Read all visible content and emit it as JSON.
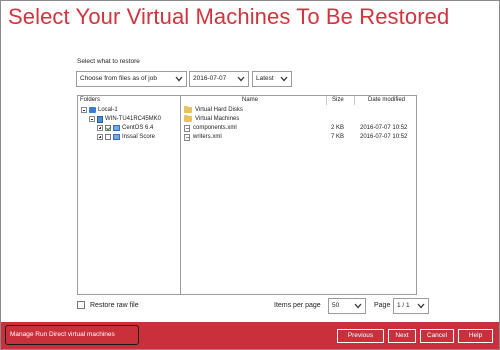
{
  "title": "Select Your Virtual Machines To Be Restored",
  "restore": {
    "label": "Select what to restore",
    "source_option": "Choose from files as of job",
    "date": "2016-07-07",
    "version": "Latest"
  },
  "browser": {
    "folders_header": "Folders",
    "columns": {
      "name": "Name",
      "size": "Size",
      "date": "Date modified"
    },
    "tree": [
      {
        "label": "Local-1",
        "expander": "minus"
      },
      {
        "label": "WIN-TU41RC45MK0",
        "expander": "minus"
      },
      {
        "label": "CentOS 6.4",
        "expander": "plus",
        "checked": true
      },
      {
        "label": "Inssal Score",
        "expander": "plus",
        "checked": false
      }
    ],
    "files": [
      {
        "name": "Virtual Hard Disks",
        "type": "folder",
        "size": "",
        "date": ""
      },
      {
        "name": "Virtual Machines",
        "type": "folder",
        "size": "",
        "date": ""
      },
      {
        "name": "components.xml",
        "type": "file",
        "size": "2 KB",
        "date": "2016-07-07 10:52"
      },
      {
        "name": "writers.xml",
        "type": "file",
        "size": "7 KB",
        "date": "2016-07-07 10:52"
      }
    ]
  },
  "restore_raw_label": "Restore raw file",
  "pagination": {
    "items_label": "Items per page",
    "items_value": "50",
    "page_label": "Page",
    "page_value": "1 / 1"
  },
  "footer": {
    "manage_label": "Manage Run Direct virtual machines",
    "previous": "Previous",
    "next": "Next",
    "cancel": "Cancel",
    "help": "Help"
  },
  "colors": {
    "accent": "#c9303c",
    "title": "#d0343c"
  }
}
